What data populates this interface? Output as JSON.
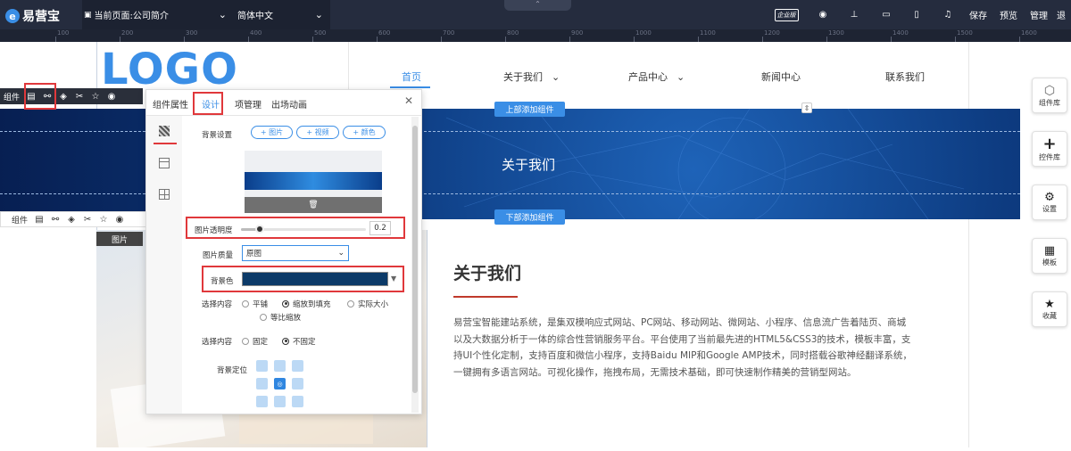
{
  "topbar": {
    "brand": "易营宝",
    "current_page": "当前页面:公司简介",
    "language": "简体中文",
    "edition_badge": "企业版",
    "save": "保存",
    "preview": "预览",
    "manage": "管理",
    "exit_partial": "退"
  },
  "ruler": {
    "ticks": [
      "100",
      "200",
      "300",
      "400",
      "500",
      "600",
      "700",
      "800",
      "900",
      "1000",
      "1100",
      "1200",
      "1300",
      "1400",
      "1500",
      "1600"
    ]
  },
  "site": {
    "logo": "LOGO",
    "nav": [
      "首页",
      "关于我们",
      "产品中心",
      "新闻中心",
      "联系我们"
    ],
    "hero_title": "关于我们",
    "add_top": "上部添加组件",
    "add_bottom": "下部添加组件",
    "section_title": "关于我们",
    "section_body": "易营宝智能建站系统，是集双模响应式网站、PC网站、移动网站、微网站、小程序、信息流广告着陆页、商城以及大数据分析于一体的综合性营销服务平台。平台使用了当前最先进的HTML5&CSS3的技术，模板丰富，支持UI个性化定制，支持百度和微信小程序，支持Baidu MIP和Google AMP技术，同时搭载谷歌神经翻译系统，一键拥有多语言网站。可视化操作，拖拽布局，无需技术基础，即可快速制作精美的营销型网站。",
    "image_tag": "图片"
  },
  "toolbar": {
    "component_label": "组件"
  },
  "panel": {
    "tabs": [
      "组件属性",
      "设计",
      "项管理",
      "出场动画"
    ],
    "bg_setting_label": "背景设置",
    "add_image": "+ 图片",
    "add_video": "+ 视频",
    "add_color": "+ 颜色",
    "opacity_label": "图片透明度",
    "opacity_value": "0.2",
    "opacity_fraction": 0.15,
    "quality_label": "图片质量",
    "quality_value": "原图",
    "bg_color_label": "背景色",
    "bg_color": "#0c3a68",
    "select_content_label": "选择内容",
    "fill_options": [
      "平铺",
      "缩放到填充",
      "实际大小",
      "等比缩放"
    ],
    "fill_selected": "缩放到填充",
    "select_content_label2": "选择内容",
    "fixed_options": [
      "固定",
      "不固定"
    ],
    "fixed_selected": "不固定",
    "bg_position_label": "背景定位"
  },
  "right_sidebar": [
    {
      "label": "组件库",
      "icon": "cube-icon"
    },
    {
      "label": "控件库",
      "icon": "plus-icon"
    },
    {
      "label": "设置",
      "icon": "gear-icon"
    },
    {
      "label": "模板",
      "icon": "grid-icon"
    },
    {
      "label": "收藏",
      "icon": "star-icon"
    }
  ],
  "colors": {
    "accent": "#3a8ee6",
    "highlight": "#e0383b",
    "topbar": "#252c3e"
  }
}
